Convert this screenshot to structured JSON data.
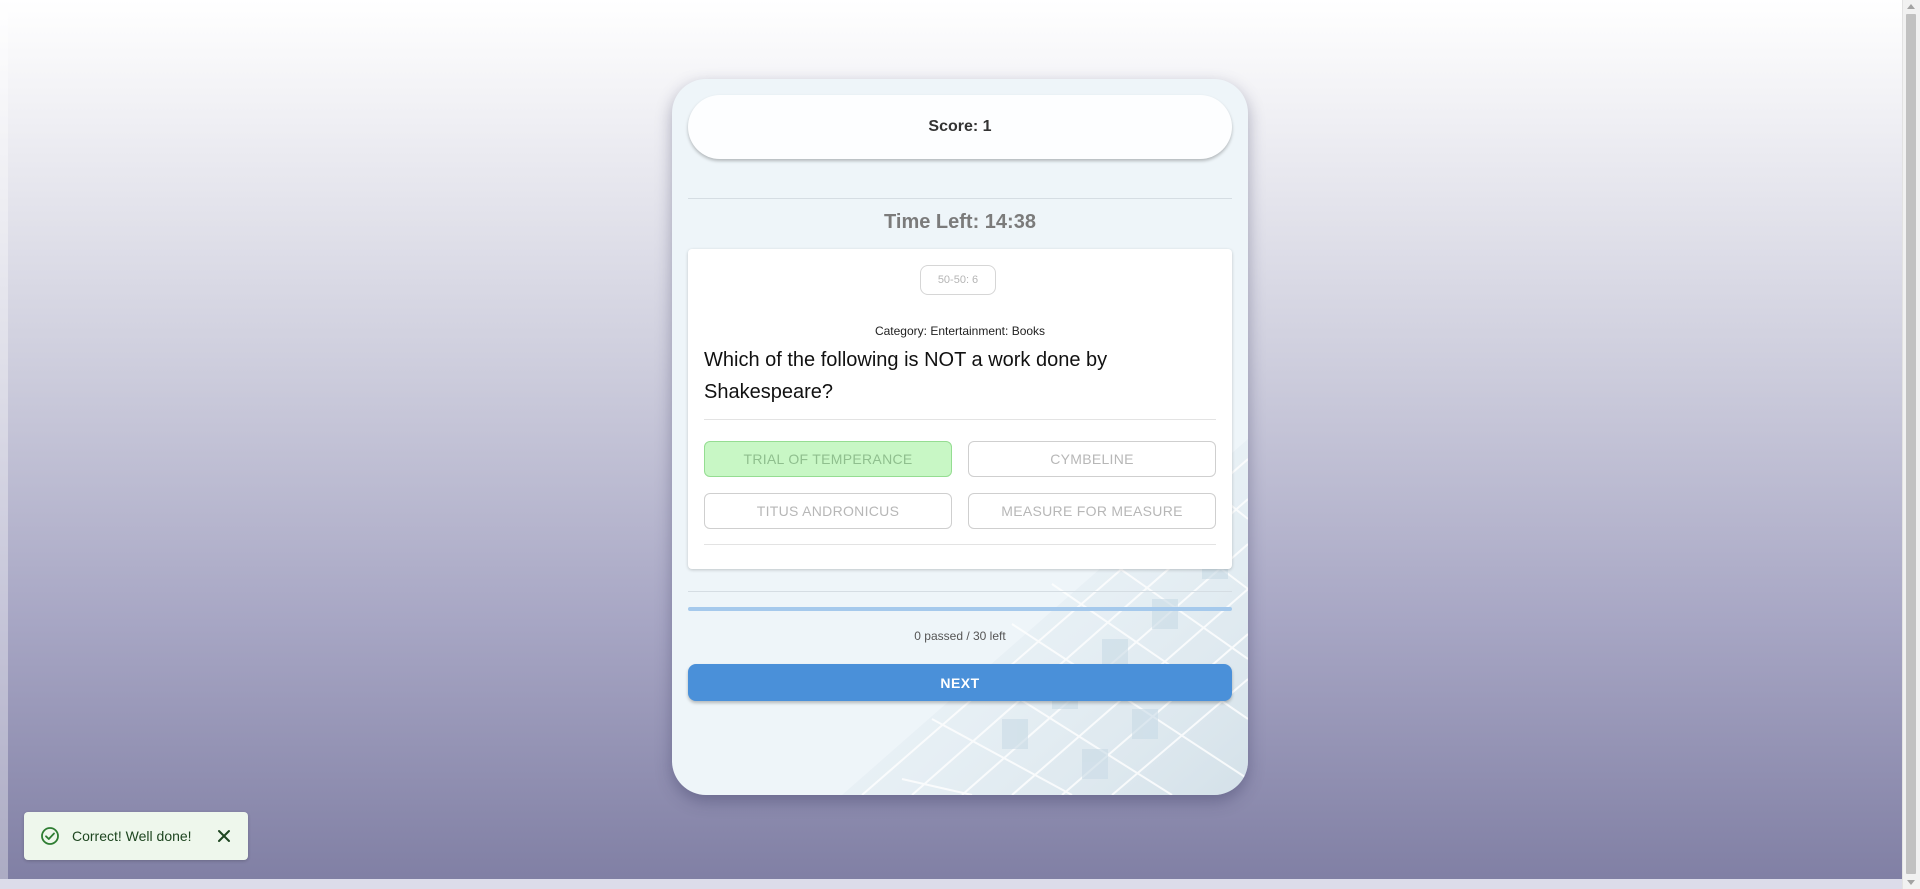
{
  "quiz": {
    "score_text": "Score: 1",
    "timer_text": "Time Left: 14:38",
    "lifeline_label": "50-50: 6",
    "category_text": "Category: Entertainment: Books",
    "question_text": "Which of the following is NOT a work done by Shakespeare?",
    "answers": [
      {
        "label": "TRIAL OF TEMPERANCE",
        "state": "correct"
      },
      {
        "label": "CYMBELINE",
        "state": "disabled"
      },
      {
        "label": "TITUS ANDRONICUS",
        "state": "disabled"
      },
      {
        "label": "MEASURE FOR MEASURE",
        "state": "disabled"
      }
    ],
    "progress_fraction": 0,
    "passed_text": "0 passed / 30 left",
    "next_label": "NEXT"
  },
  "toast": {
    "message": "Correct! Well done!",
    "icon": "check-circle-icon",
    "close_icon": "close-icon"
  },
  "colors": {
    "accent": "#4a90d9",
    "correct_bg": "#c8f7c5",
    "toast_bg": "#eef7ec",
    "toast_icon": "#2e7d32"
  }
}
